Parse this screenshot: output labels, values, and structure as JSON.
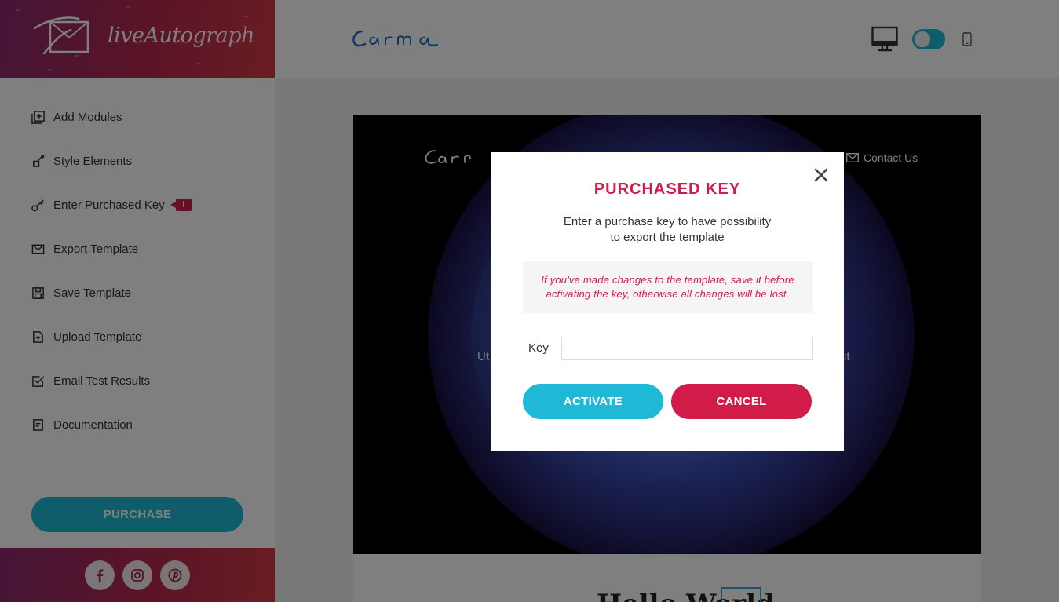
{
  "brand": {
    "name": "liveAutograph",
    "logo_icon": "signature-envelope-icon",
    "gradient": [
      "#8a2a6e",
      "#d33a45"
    ]
  },
  "sidebar": {
    "items": [
      {
        "label": "Add Modules",
        "icon": "add-modules-icon"
      },
      {
        "label": "Style Elements",
        "icon": "style-brush-icon"
      },
      {
        "label": "Enter Purchased Key",
        "icon": "key-icon",
        "badge": "!"
      },
      {
        "label": "Export Template",
        "icon": "envelope-icon"
      },
      {
        "label": "Save Template",
        "icon": "save-icon"
      },
      {
        "label": "Upload Template",
        "icon": "upload-file-icon"
      },
      {
        "label": "Email Test Results",
        "icon": "checkbox-icon"
      },
      {
        "label": "Documentation",
        "icon": "document-icon"
      }
    ],
    "purchase_label": "PURCHASE",
    "social": [
      "facebook-icon",
      "instagram-icon",
      "pinterest-icon"
    ]
  },
  "topbar": {
    "template_logo": "Carma",
    "devices": [
      "desktop-icon",
      "view-toggle",
      "mobile-icon"
    ]
  },
  "preview": {
    "hero_logo": "Carma",
    "contact_label": "Contact Us",
    "text_left": "Ut",
    "text_right": "ut",
    "hello_text": "Hello World"
  },
  "modal": {
    "title": "PURCHASED KEY",
    "subtitle_line1": "Enter a purchase key to have possibility",
    "subtitle_line2": "to export the template",
    "warning_line1": "If you've made changes to the template, save it before",
    "warning_line2": "activating the key, otherwise all changes will be lost.",
    "key_label": "Key",
    "key_value": "",
    "activate_label": "ACTIVATE",
    "cancel_label": "CANCEL"
  },
  "colors": {
    "accent": "#1fb8d6",
    "danger": "#d11c4a",
    "overlay": "rgba(0,0,0,0.5)"
  }
}
